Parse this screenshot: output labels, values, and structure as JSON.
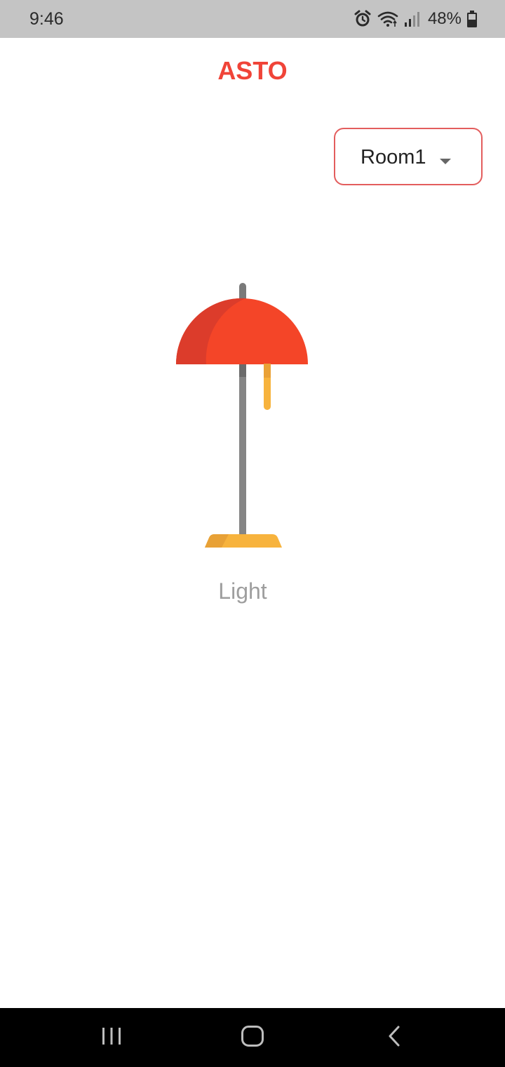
{
  "status_bar": {
    "time": "9:46",
    "battery_percent": "48%",
    "icons": [
      "alarm-icon",
      "wifi-icon",
      "signal-icon",
      "battery-icon"
    ]
  },
  "app": {
    "title": "ASTO",
    "title_color": "#f04438"
  },
  "room_selector": {
    "selected": "Room1",
    "border_color": "#e35d5d"
  },
  "devices": [
    {
      "label": "Light",
      "icon": "floor-lamp-icon",
      "label_color": "#9e9e9e"
    }
  ],
  "nav_bar": {
    "buttons": [
      "recent-apps-icon",
      "home-icon",
      "back-icon"
    ]
  }
}
